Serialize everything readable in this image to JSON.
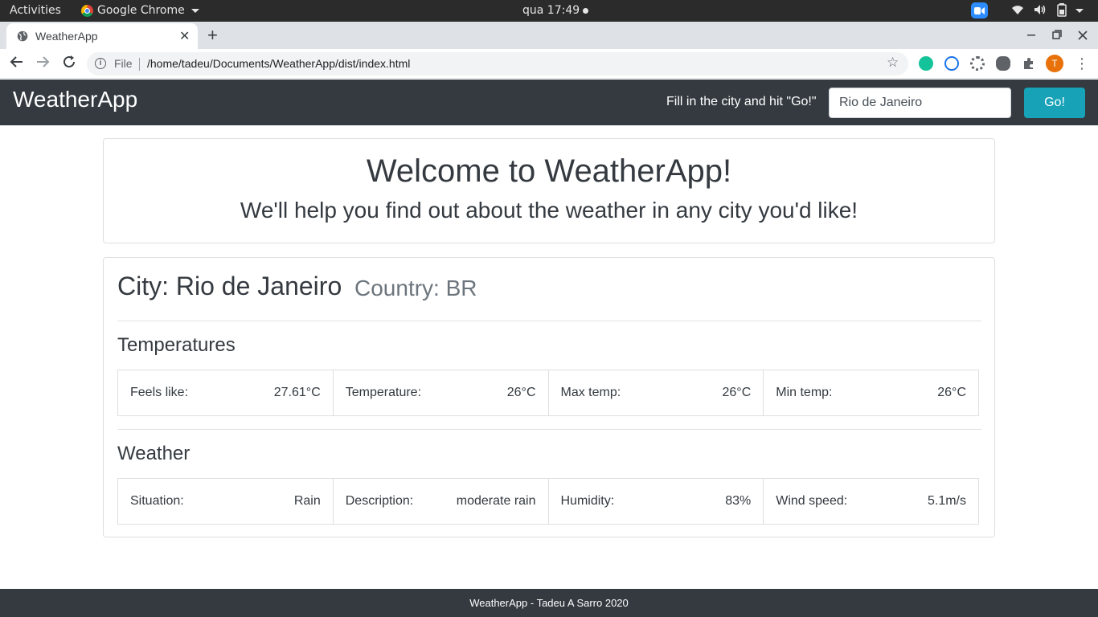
{
  "os": {
    "activities": "Activities",
    "app_name": "Google Chrome",
    "clock": "qua 17:49"
  },
  "browser": {
    "tab_title": "WeatherApp",
    "tab_close": "✕",
    "new_tab": "+",
    "scheme": "File",
    "url": "/home/tadeu/Documents/WeatherApp/dist/index.html",
    "profile_initial": "T"
  },
  "navbar": {
    "brand": "WeatherApp",
    "hint": "Fill in the city and hit \"Go!\"",
    "city_value": "Rio de Janeiro",
    "go_label": "Go!"
  },
  "welcome": {
    "title": "Welcome to WeatherApp!",
    "subtitle": "We'll help you find out about the weather in any city you'd like!"
  },
  "result": {
    "city": "City: Rio de Janeiro",
    "country": "Country: BR",
    "temperatures": {
      "heading": "Temperatures",
      "items": [
        {
          "label": "Feels like:",
          "value": "27.61°C"
        },
        {
          "label": "Temperature:",
          "value": "26°C"
        },
        {
          "label": "Max temp:",
          "value": "26°C"
        },
        {
          "label": "Min temp:",
          "value": "26°C"
        }
      ]
    },
    "weather": {
      "heading": "Weather",
      "items": [
        {
          "label": "Situation:",
          "value": "Rain"
        },
        {
          "label": "Description:",
          "value": "moderate rain"
        },
        {
          "label": "Humidity:",
          "value": "83%"
        },
        {
          "label": "Wind speed:",
          "value": "5.1m/s"
        }
      ]
    }
  },
  "footer": {
    "text": "WeatherApp - Tadeu A Sarro 2020"
  },
  "colors": {
    "navbar_bg": "#343a40",
    "go_button": "#17a2b8",
    "muted": "#6c757d"
  }
}
